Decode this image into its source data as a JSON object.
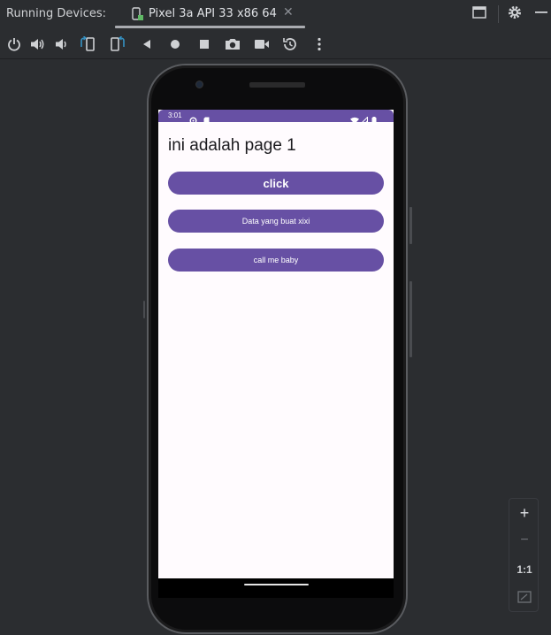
{
  "window": {
    "running_devices_label": "Running Devices:",
    "device_tab_label": "Pixel 3a API 33 x86 64",
    "tab_close_glyph": "✕",
    "tab_icon": "device-icon",
    "right_icons": [
      "restore-window-icon",
      "gear-icon",
      "minimize-icon"
    ]
  },
  "toolbar": {
    "items": [
      {
        "name": "power-icon"
      },
      {
        "name": "volume-up-icon"
      },
      {
        "name": "volume-down-icon"
      },
      {
        "name": "rotate-left-icon"
      },
      {
        "name": "rotate-right-icon"
      },
      {
        "name": "back-icon"
      },
      {
        "name": "home-icon"
      },
      {
        "name": "overview-icon"
      },
      {
        "name": "camera-icon"
      },
      {
        "name": "video-icon"
      },
      {
        "name": "snapshot-icon"
      },
      {
        "name": "more-icon"
      }
    ]
  },
  "phone": {
    "status_bar": {
      "time": "3:01",
      "color": "#6750a4"
    },
    "app": {
      "title": "ini adalah page 1",
      "buttons": [
        {
          "label": "click"
        },
        {
          "label": "Data yang buat xixi"
        },
        {
          "label": "call me baby"
        }
      ],
      "accent_color": "#6750a4",
      "background_color": "#fffbfe"
    }
  },
  "zoom_panel": {
    "zoom_in_label": "+",
    "zoom_out_label": "−",
    "actual_size_label": "1:1",
    "fit_icon": "fit-screen-icon"
  }
}
